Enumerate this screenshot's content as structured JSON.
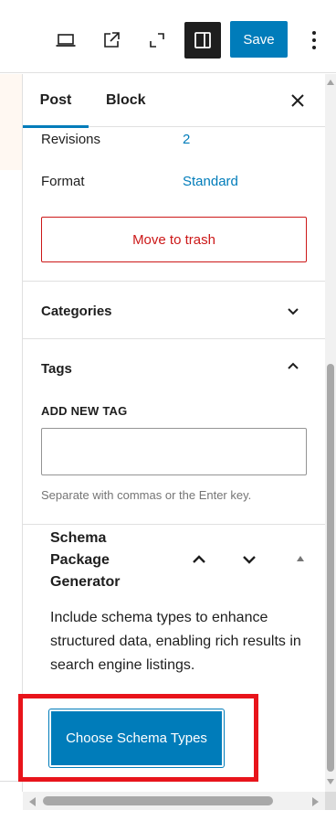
{
  "toolbar": {
    "icons": {
      "preview": "laptop-preview-icon",
      "external": "external-link-icon",
      "fullscreen": "fullscreen-icon",
      "sidebar_toggle": "sidebar-toggle-icon",
      "more": "vertical-ellipsis-icon"
    },
    "save_label": "Save"
  },
  "sidebar": {
    "tabs": [
      {
        "label": "Post",
        "active": true
      },
      {
        "label": "Block",
        "active": false
      }
    ],
    "close_icon": "close-icon",
    "revisions": {
      "label": "Revisions",
      "value": "2"
    },
    "format": {
      "label": "Format",
      "value": "Standard"
    },
    "trash_label": "Move to trash",
    "categories": {
      "title": "Categories",
      "expanded": false
    },
    "tags": {
      "title": "Tags",
      "expanded": true,
      "add_label": "ADD NEW TAG",
      "input_value": "",
      "help": "Separate with commas or the Enter key."
    },
    "schema": {
      "title": "Schema Package Generator",
      "description": "Include schema types to enhance structured data, enabling rich results in search engine listings.",
      "button_label": "Choose Schema Types"
    }
  },
  "colors": {
    "accent": "#007cba",
    "danger": "#cc1818",
    "highlight": "#e8141b",
    "text": "#1e1e1e",
    "muted": "#757575"
  }
}
